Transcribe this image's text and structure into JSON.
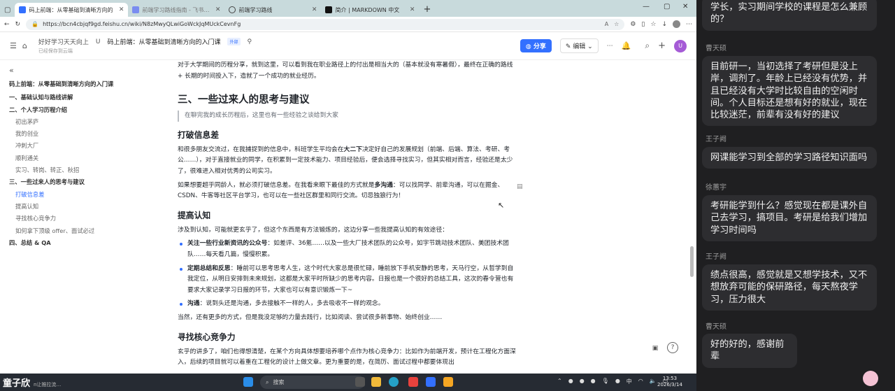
{
  "browser": {
    "tabs": [
      {
        "label": "码上前端：从零基础到清晰方向的",
        "color": "#3370ff",
        "active": true
      },
      {
        "label": "前端学习路线指南 - 飞书云文档",
        "color": "#7a8cf0",
        "active": false
      },
      {
        "label": "前端学习路线",
        "color": "#444",
        "active": false
      },
      {
        "label": "简介 | MARKDOWN 中文",
        "color": "#111",
        "active": false
      }
    ],
    "new_tab": "+",
    "url": "https://bcn4cbjqf9gd.feishu.cn/wiki/N8zMwyQLwiGoWckJqMUckCevnFg"
  },
  "doc_header": {
    "breadcrumb": [
      "好好学习天天向上",
      "U",
      "码上前端：从零基础到清晰方向的入门课"
    ],
    "tag": "外部",
    "saved_text": "已经保存到云端",
    "share_label": "分享",
    "edit_label": "编辑",
    "avatar_letter": "U"
  },
  "toc": [
    {
      "label": "码上前端：从零基础到清晰方向的入门课",
      "level": 0,
      "bold": true
    },
    {
      "label": "一、基础认知与路线讲解",
      "level": 1,
      "bold": true
    },
    {
      "label": "二、个人学习历程介绍",
      "level": 1,
      "bold": true
    },
    {
      "label": "初出茅庐",
      "level": 2
    },
    {
      "label": "我的创业",
      "level": 2
    },
    {
      "label": "冲刺大厂",
      "level": 2
    },
    {
      "label": "顺利通关",
      "level": 2
    },
    {
      "label": "实习、转岗、转正、秋招",
      "level": 2
    },
    {
      "label": "三、一些过来人的思考与建议",
      "level": 1,
      "bold": true
    },
    {
      "label": "打破信息差",
      "level": 2,
      "active": true
    },
    {
      "label": "提高认知",
      "level": 2
    },
    {
      "label": "寻找核心竞争力",
      "level": 2
    },
    {
      "label": "如何拿下顶级 offer、面试必过",
      "level": 2
    },
    {
      "label": "四、总结 & QA",
      "level": 1,
      "bold": true
    }
  ],
  "content": {
    "intro_para": "对于大学期间的历程分享，就到这里，可以看到我在职业路径上的付出是相当大的（基本就没有寒暑假），最终在正确的路线 + 长期的时间投入下，造就了一个成功的就业经历。",
    "h2": "三、一些过来人的思考与建议",
    "quote": "在聊完我的成长历程后，这里也有一些经验之谈给到大家",
    "h3_1": "打破信息差",
    "p1_a": "和很多朋友交流过，在我捕捉到的信息中，科班学生平均会在",
    "p1_b": "大二下",
    "p1_c": "决定好自己的发展规划（前端、后端、算法、考研、考公……），对于直接就业的同学，在积累到一定技术能力、项目经验后，便会选择寻找实习，但其实相对而言，经验还是太少了，很难进入相对优秀的公司实习。",
    "p2_a": "如果想要超乎同龄人，就必须打破信息差。在我看来眼下最佳的方式就是",
    "p2_b": "多沟通",
    "p2_c": "：可以找同学、前辈沟通，可以在掘金、CSDN、牛客等社区平台学习，也可以在一些社区群里和同行交流。切忌独狼行为！",
    "h3_2": "提高认知",
    "p3": "涉及到认知，可能就更玄乎了，但这个东西是有方法锻炼的，这边分享一些我提高认知的有效途径：",
    "bullets": [
      {
        "bold": "关注一些行业新资讯的公众号",
        "text": "：如差评、36氪……以及一些大厂技术团队的公众号，如字节跳动技术团队、美团技术团队……每天看几篇，慢慢积累。"
      },
      {
        "bold": "定期总结和反思",
        "text": "：睡前可以思考思考人生，这个时代大家总是很忙碌，睡前放下手机安静的思考，天马行空，从哲学到自我定位，从明日安排到未来规划，这都是大家平时所缺少的思考内容。日报也是一个很好的总结工具，这次的春令营也有要求大家记录学习日报的环节，大家也可以有意识锻炼一下~"
      },
      {
        "bold": "沟通",
        "text": "：说到头还是沟通，多去接触不一样的人，多去吸收不一样的观念。"
      }
    ],
    "p4": "当然，还有更多的方式，但是我没足够的力量去践行，比如阅读、尝试很多新事物、始终创业……",
    "h3_3": "寻找核心竞争力",
    "p5": "玄乎的讲多了，咱们也得想清楚，在某个方向具体想要培养哪个点作为核心竞争力：比如作为前端开发，预计在工程化方面深入，后续的项目就可以着重在工程化的设计上做文章。更为重要的是，在简历、面试过程中都要体现出"
  },
  "chat": {
    "messages": [
      {
        "sender": "",
        "text": "学长，实习期间学校的课程是怎么兼顾的？"
      },
      {
        "sender": "曹天硕",
        "text": "目前研一，当初选择了考研但是没上岸，调剂了。年龄上已经没有优势，并且已经没有大学时比较自由的空闲时间。个人目标还是想有好的就业，现在比较迷茫，前辈有没有好的建议"
      },
      {
        "sender": "王子阙",
        "text": "网课能学习到全部的学习路径知识面吗"
      },
      {
        "sender": "徐蕙宇",
        "text": "考研能学到什么？感觉现在都是课外自己去学习，搞项目。考研是给我们增加学习时间吗"
      },
      {
        "sender": "王子阙",
        "text": "绩点很高，感觉就是又想学技术，又不想放弃可能的保研路径，每天熬夜学习，压力很大"
      },
      {
        "sender": "曹天硕",
        "text": "好的好的，感谢前辈"
      }
    ]
  },
  "taskbar": {
    "presenter_name": "童子欣",
    "presenter_sub": "n让推拉流…",
    "search_placeholder": "搜索",
    "ime": "中",
    "time": "13:53",
    "date": "2026/3/14"
  }
}
